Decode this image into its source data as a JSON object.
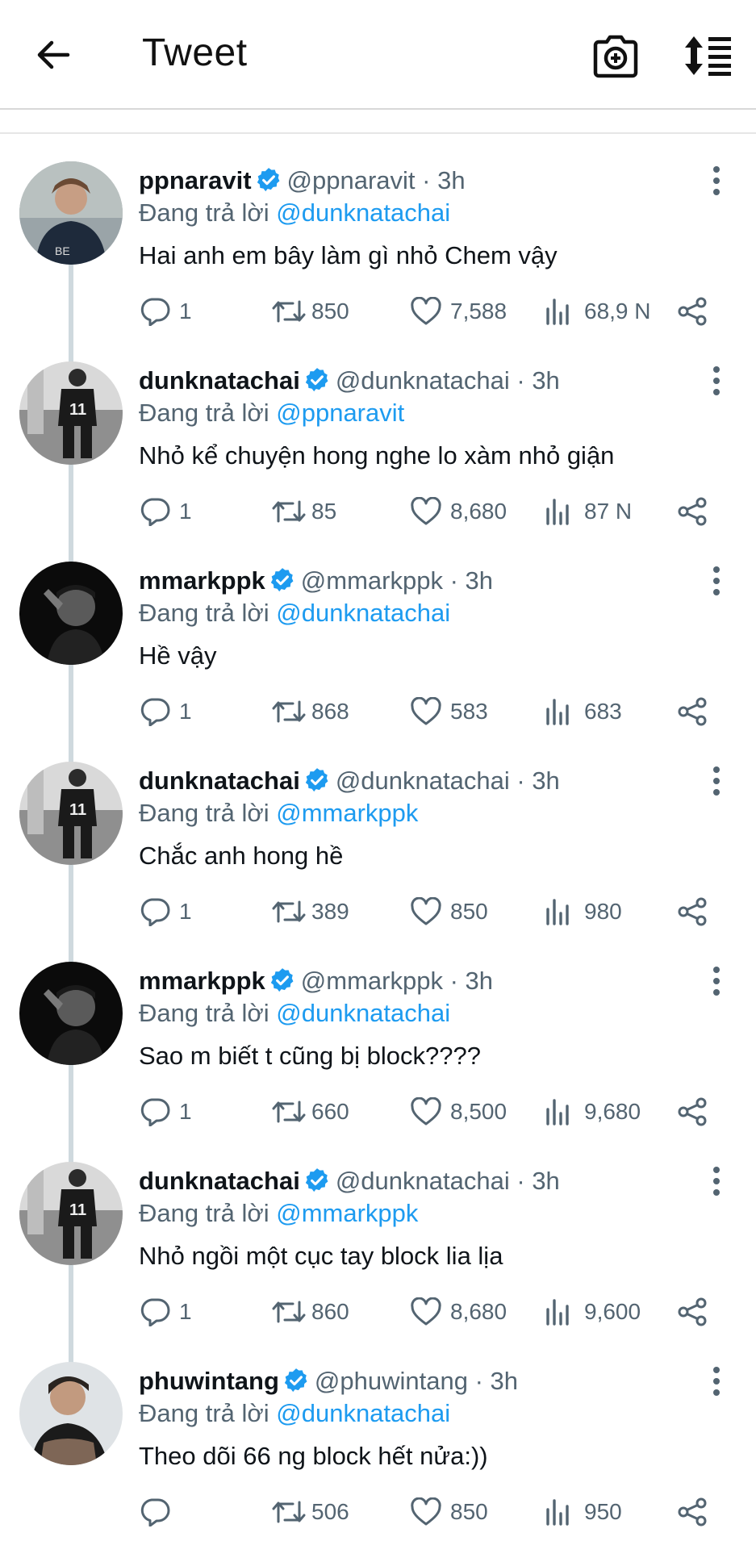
{
  "header": {
    "title": "Tweet",
    "back_icon": "arrow-left-icon",
    "camera_icon": "camera-add-icon",
    "sort_icon": "sort-icon"
  },
  "colors": {
    "accent": "#1d9bf0",
    "text": "#0f1419",
    "muted": "#536471",
    "thread_line": "#cfd9de"
  },
  "reply_label": "Đang trả lời",
  "tweets": [
    {
      "name": "ppnaravit",
      "handle": "@ppnaravit",
      "sep": "·",
      "time": "3h",
      "reply_to": "@dunknatachai",
      "text": "Hai anh em bây làm gì nhỏ Chem vậy",
      "replies": "1",
      "retweets": "850",
      "likes": "7,588",
      "views": "68,9 N"
    },
    {
      "name": "dunknatachai",
      "handle": "@dunknatachai",
      "sep": "·",
      "time": "3h",
      "reply_to": "@ppnaravit",
      "text": "Nhỏ kể chuyện hong nghe lo xàm nhỏ giận",
      "replies": "1",
      "retweets": "85",
      "likes": "8,680",
      "views": "87 N"
    },
    {
      "name": "mmarkppk",
      "handle": "@mmarkppk",
      "sep": "·",
      "time": "3h",
      "reply_to": "@dunknatachai",
      "text": "Hề vậy",
      "replies": "1",
      "retweets": "868",
      "likes": "583",
      "views": "683"
    },
    {
      "name": "dunknatachai",
      "handle": "@dunknatachai",
      "sep": "·",
      "time": "3h",
      "reply_to": "@mmarkppk",
      "text": "Chắc anh hong hề",
      "replies": "1",
      "retweets": "389",
      "likes": "850",
      "views": "980"
    },
    {
      "name": "mmarkppk",
      "handle": "@mmarkppk",
      "sep": "·",
      "time": "3h",
      "reply_to": "@dunknatachai",
      "text": "Sao m biết t cũng bị block????",
      "replies": "1",
      "retweets": "660",
      "likes": "8,500",
      "views": "9,680"
    },
    {
      "name": "dunknatachai",
      "handle": "@dunknatachai",
      "sep": "·",
      "time": "3h",
      "reply_to": "@mmarkppk",
      "text": "Nhỏ ngồi một cục tay block lia lịa",
      "replies": "1",
      "retweets": "860",
      "likes": "8,680",
      "views": "9,600"
    },
    {
      "name": "phuwintang",
      "handle": "@phuwintang",
      "sep": "·",
      "time": "3h",
      "reply_to": "@dunknatachai",
      "text": "Theo dõi 66 ng block hết nửa:))",
      "replies": "",
      "retweets": "506",
      "likes": "850",
      "views": "950"
    }
  ]
}
